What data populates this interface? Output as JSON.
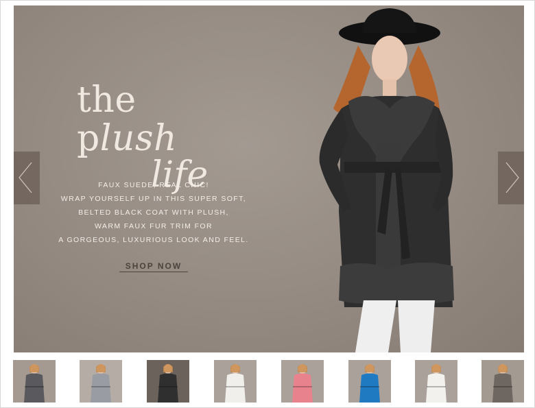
{
  "hero": {
    "headline_line1_a": "the p",
    "headline_line1_b": "lush",
    "headline_line2": "life",
    "copy_lines": [
      "FAUX SUEDE, REAL CHIC!",
      "WRAP YOURSELF UP IN THIS SUPER SOFT,",
      "BELTED BLACK COAT WITH PLUSH,",
      "WARM FAUX FUR TRIM FOR",
      "A GORGEOUS, LUXURIOUS LOOK AND FEEL."
    ],
    "cta": "SHOP NOW",
    "background_color": "#948a82",
    "coat_color": "#2e2e2e",
    "pants_color": "#efefef"
  },
  "nav": {
    "prev_icon": "chevron-left-icon",
    "next_icon": "chevron-right-icon"
  },
  "thumbnails": [
    {
      "name": "grey-fur-collar-coat",
      "bg": "#a49a92",
      "coat": "#5a5a5e"
    },
    {
      "name": "silver-puffer-jacket",
      "bg": "#b5aca5",
      "coat": "#9a9ca3"
    },
    {
      "name": "black-suede-coat",
      "bg": "#6b625b",
      "coat": "#2f2f2f"
    },
    {
      "name": "white-puffer-jacket",
      "bg": "#aaa19a",
      "coat": "#f1efec"
    },
    {
      "name": "pink-puffer-jacket",
      "bg": "#aaa19a",
      "coat": "#e8838e"
    },
    {
      "name": "blue-wrap-coat",
      "bg": "#aaa19a",
      "coat": "#1f7ac2"
    },
    {
      "name": "white-belted-coat",
      "bg": "#aaa19a",
      "coat": "#f3f1ee"
    },
    {
      "name": "taupe-coat-striped-scarf",
      "bg": "#a39a92",
      "coat": "#6e6660"
    }
  ]
}
